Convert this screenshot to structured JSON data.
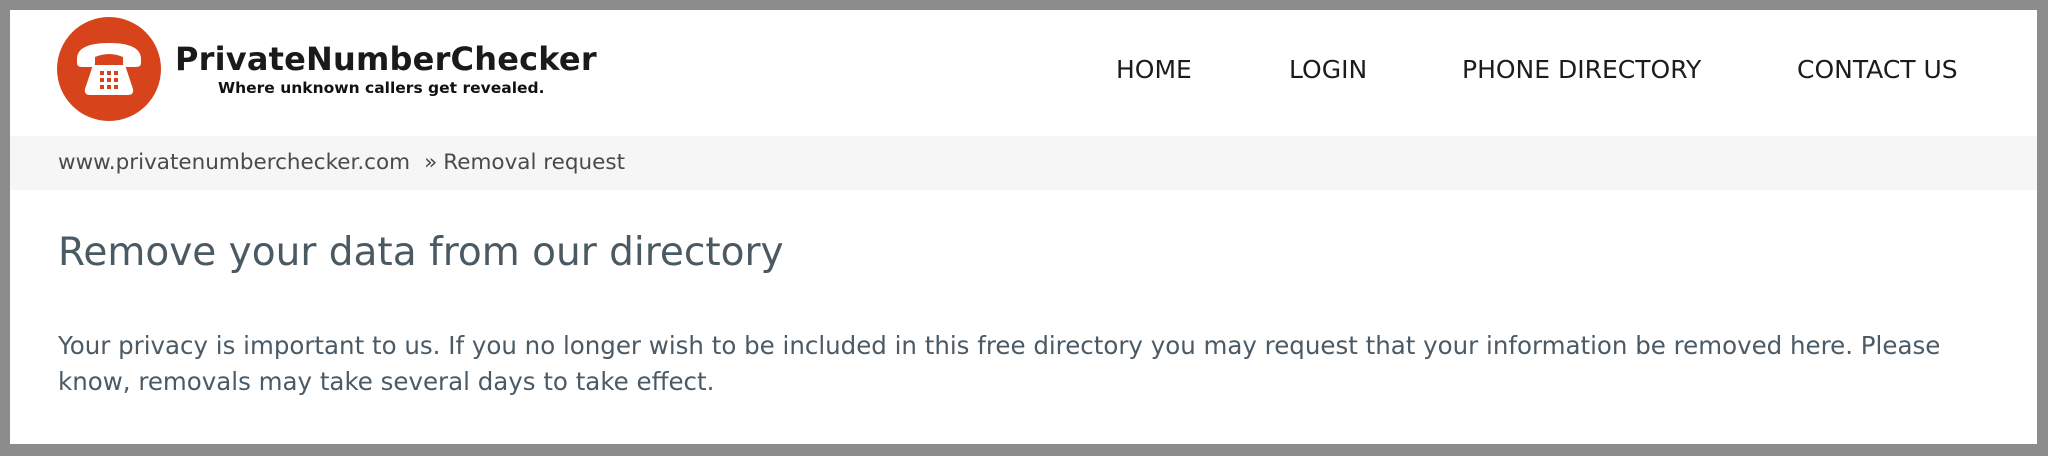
{
  "brand": {
    "name": "PrivateNumberChecker",
    "tagline": "Where unknown callers get revealed.",
    "logo_icon": "telephone-icon",
    "logo_color": "#d7431a"
  },
  "nav": {
    "items": [
      {
        "label": "HOME"
      },
      {
        "label": "LOGIN"
      },
      {
        "label": "PHONE DIRECTORY"
      },
      {
        "label": "CONTACT US"
      }
    ]
  },
  "breadcrumb": {
    "home": "www.privatenumberchecker.com",
    "separator": "»",
    "current": "Removal request"
  },
  "main": {
    "title": "Remove your data from our directory",
    "intro": "Your privacy is important to us. If you no longer wish to be included in this free directory you may request that your information be removed here. Please know, removals may take several days to take effect."
  }
}
